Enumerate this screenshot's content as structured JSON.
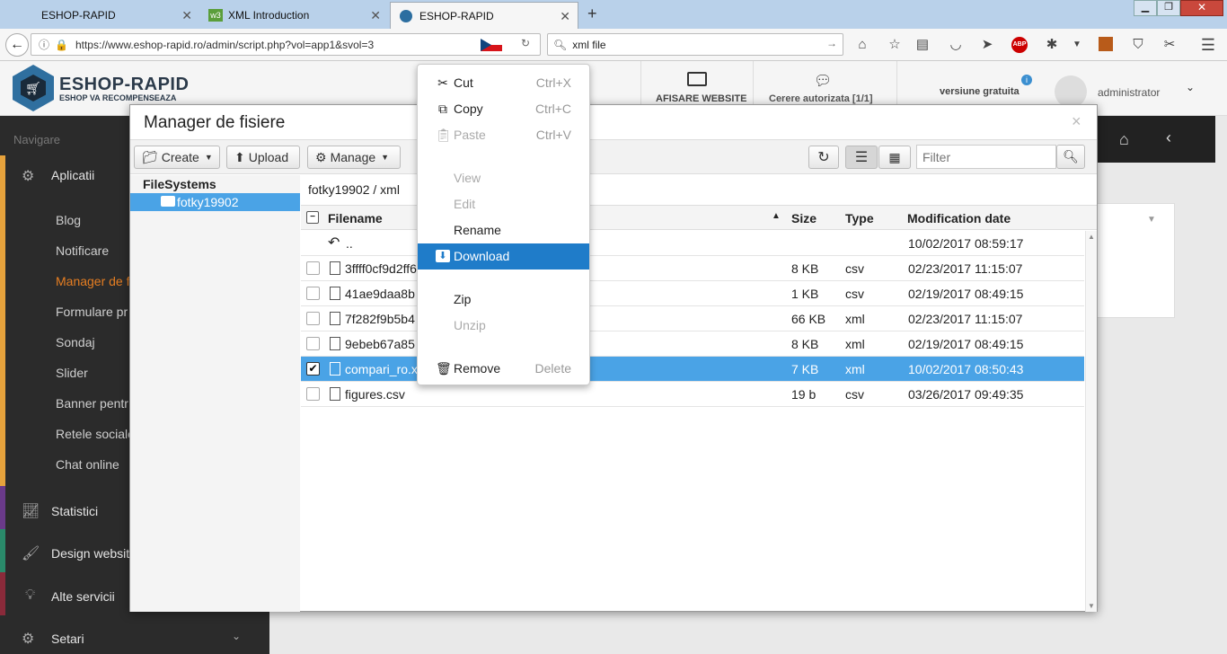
{
  "browser": {
    "tabs": [
      {
        "title": "ESHOP-RAPID"
      },
      {
        "title": "XML Introduction"
      },
      {
        "title": "ESHOP-RAPID"
      }
    ],
    "url": "https://www.eshop-rapid.ro/admin/script.php?vol=app1&svol=3",
    "search_value": "xml file",
    "new_tab": "+"
  },
  "app": {
    "logo_main": "ESHOP-RAPID",
    "logo_sub": "ESHOP VA RECOMPENSEAZA",
    "afisare": "AFISARE WEBSITE",
    "cerere": "Cerere autorizata [1/1]",
    "versiune": "versiune gratuita",
    "user": "administrator"
  },
  "sidebar": {
    "heading": "Navigare",
    "aplicatii": "Aplicatii",
    "subitems": [
      "Blog",
      "Notificare",
      "Manager de fi",
      "Formulare pr",
      "Sondaj",
      "Slider",
      "Banner pentr",
      "Retele sociale",
      "Chat online"
    ],
    "statistici": "Statistici",
    "design": "Design website",
    "alte": "Alte servicii",
    "setari": "Setari"
  },
  "modal": {
    "title": "Manager de fisiere",
    "close": "×",
    "toolbar": {
      "create": "Create",
      "upload": "Upload",
      "manage": "Manage",
      "filter_placeholder": "Filter"
    },
    "tree": {
      "heading": "FileSystems",
      "folder": "fotky19902"
    },
    "breadcrumb": "fotky19902 / xml",
    "columns": {
      "filename": "Filename",
      "size": "Size",
      "type": "Type",
      "date": "Modification date"
    },
    "up": {
      "name": "..",
      "date": "10/02/2017 08:59:17"
    },
    "files": [
      {
        "name": "3ffff0cf9d2ff6",
        "size": "8 KB",
        "type": "csv",
        "date": "02/23/2017 11:15:07"
      },
      {
        "name": "41ae9daa8b",
        "size": "1 KB",
        "type": "csv",
        "date": "02/19/2017 08:49:15"
      },
      {
        "name": "7f282f9b5b4",
        "size": "66 KB",
        "type": "xml",
        "date": "02/23/2017 11:15:07"
      },
      {
        "name": "9ebeb67a85",
        "size": "8 KB",
        "type": "xml",
        "date": "02/19/2017 08:49:15"
      },
      {
        "name": "compari_ro.x",
        "size": "7 KB",
        "type": "xml",
        "date": "10/02/2017 08:50:43"
      },
      {
        "name": "figures.csv",
        "size": "19 b",
        "type": "csv",
        "date": "03/26/2017 09:49:35"
      }
    ]
  },
  "context_menu": {
    "cut": "Cut",
    "cut_sc": "Ctrl+X",
    "copy": "Copy",
    "copy_sc": "Ctrl+C",
    "paste": "Paste",
    "paste_sc": "Ctrl+V",
    "view": "View",
    "edit": "Edit",
    "rename": "Rename",
    "download": "Download",
    "zip": "Zip",
    "unzip": "Unzip",
    "remove": "Remove",
    "delete": "Delete"
  },
  "colors": {
    "selection": "#4aa3e6",
    "menu_highlight": "#1f7cc9",
    "accent_orange": "#e67e22"
  }
}
